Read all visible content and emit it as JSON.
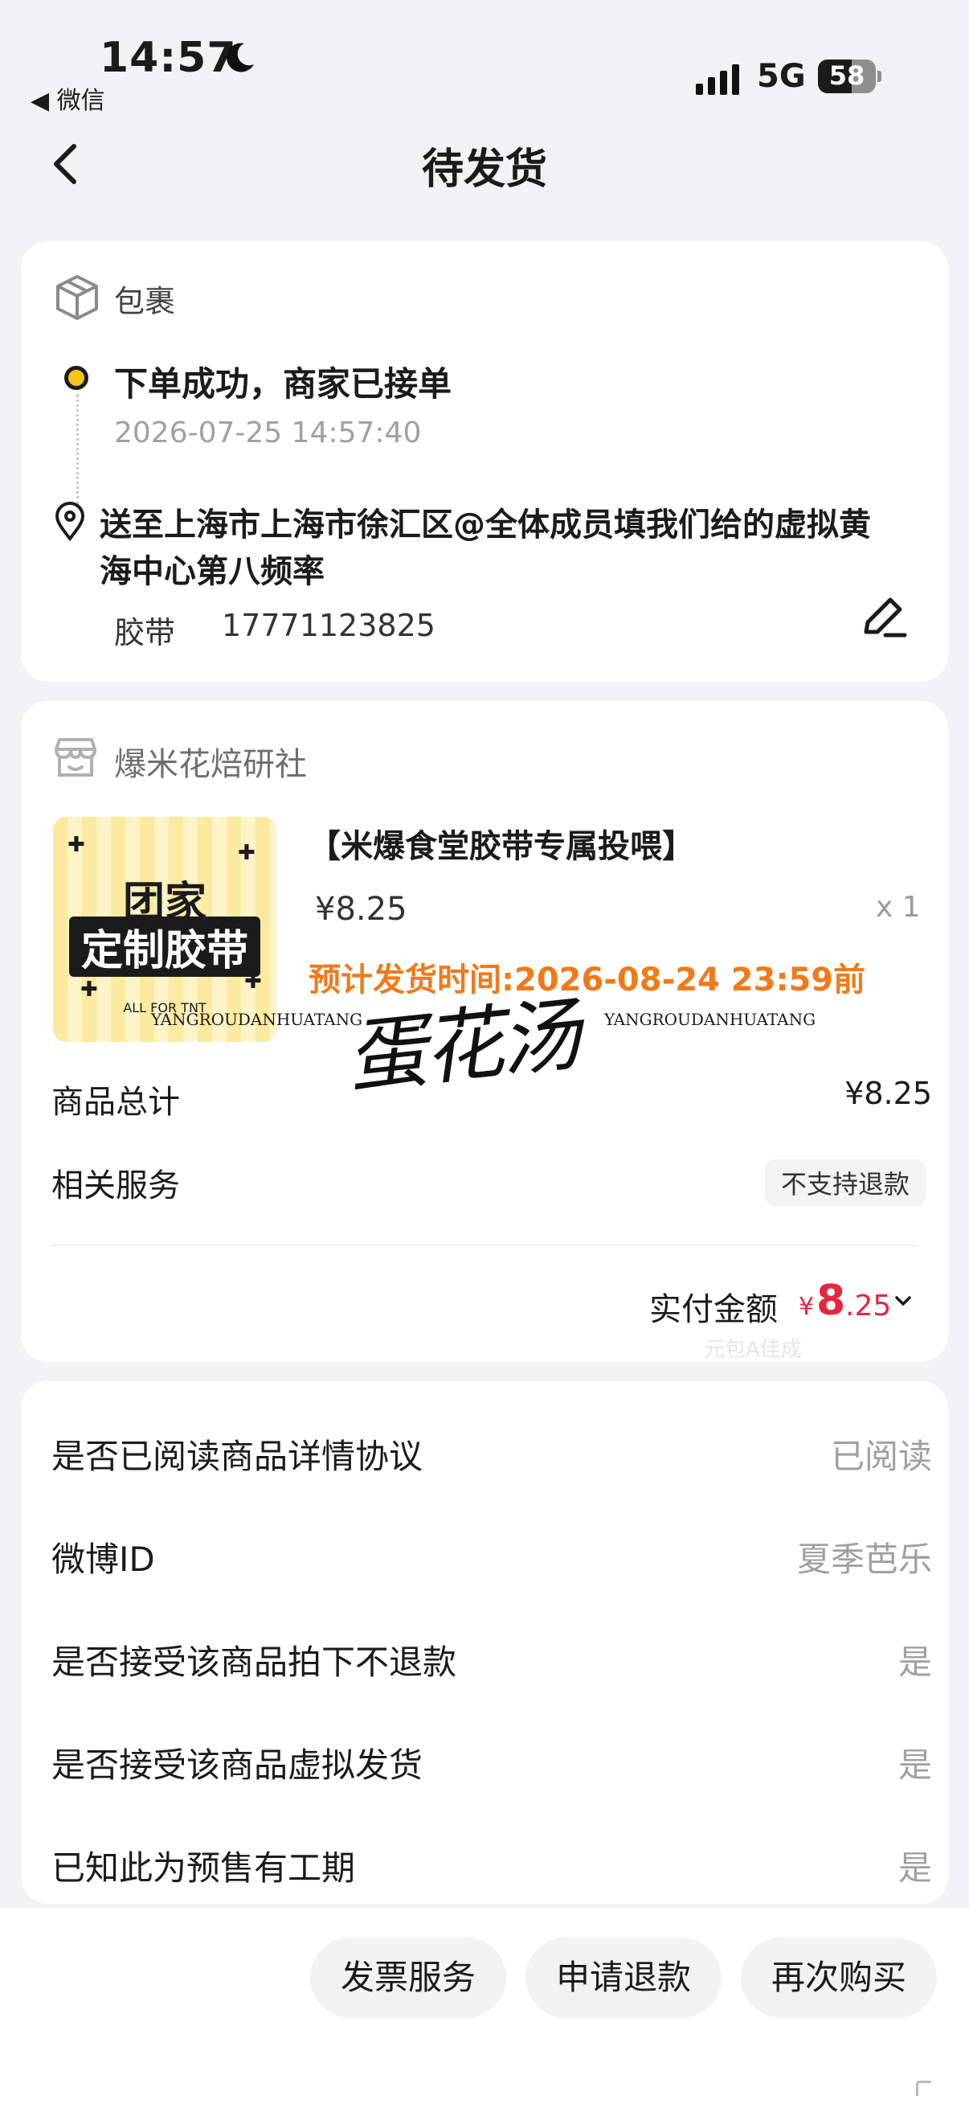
{
  "status_bar": {
    "time": "14:57",
    "back_app": "◀ 微信",
    "network": "5G",
    "battery": "58",
    "battery_level": 0.58
  },
  "nav": {
    "title": "待发货"
  },
  "package": {
    "label": "包裹",
    "status_title": "下单成功，商家已接单",
    "status_time": "2026-07-25 14:57:40",
    "address": "送至上海市上海市徐汇区@全体成员填我们给的虚拟黄海中心第八频率",
    "receiver_name": "胶带",
    "receiver_phone": "17771123825"
  },
  "shop": {
    "name": "爆米花焙研社",
    "product": {
      "image_line1": "团家",
      "image_line2": "定制胶带",
      "image_line3": "ALL FOR TNT",
      "name": "【米爆食堂胶带专属投喂】",
      "price": "¥8.25",
      "qty": "x 1",
      "ship_time": "预计发货时间:2026-08-24 23:59前"
    },
    "watermark": {
      "left": "YANGROUDANHUATANG",
      "right": "YANGROUDANHUATANG",
      "signature": "蛋花汤",
      "small": "元包A佳成"
    },
    "total_label": "商品总计",
    "total_value": "¥8.25",
    "service_label": "相关服务",
    "service_badge": "不支持退款",
    "paid_label": "实付金额",
    "paid_currency": "¥",
    "paid_int": "8",
    "paid_dec": ".25"
  },
  "info_rows": [
    {
      "label": "是否已阅读商品详情协议",
      "value": "已阅读"
    },
    {
      "label": "微博ID",
      "value": "夏季芭乐"
    },
    {
      "label": "是否接受该商品拍下不退款",
      "value": "是"
    },
    {
      "label": "是否接受该商品虚拟发货",
      "value": "是"
    },
    {
      "label": "已知此为预售有工期",
      "value": "是"
    }
  ],
  "actions": {
    "invoice": "发票服务",
    "refund": "申请退款",
    "rebuy": "再次购买"
  },
  "colors": {
    "accent_yellow": "#f5c518",
    "price_red": "#e5273d",
    "ship_orange": "#f07a1a",
    "page_bg": "#f2f2f4"
  }
}
